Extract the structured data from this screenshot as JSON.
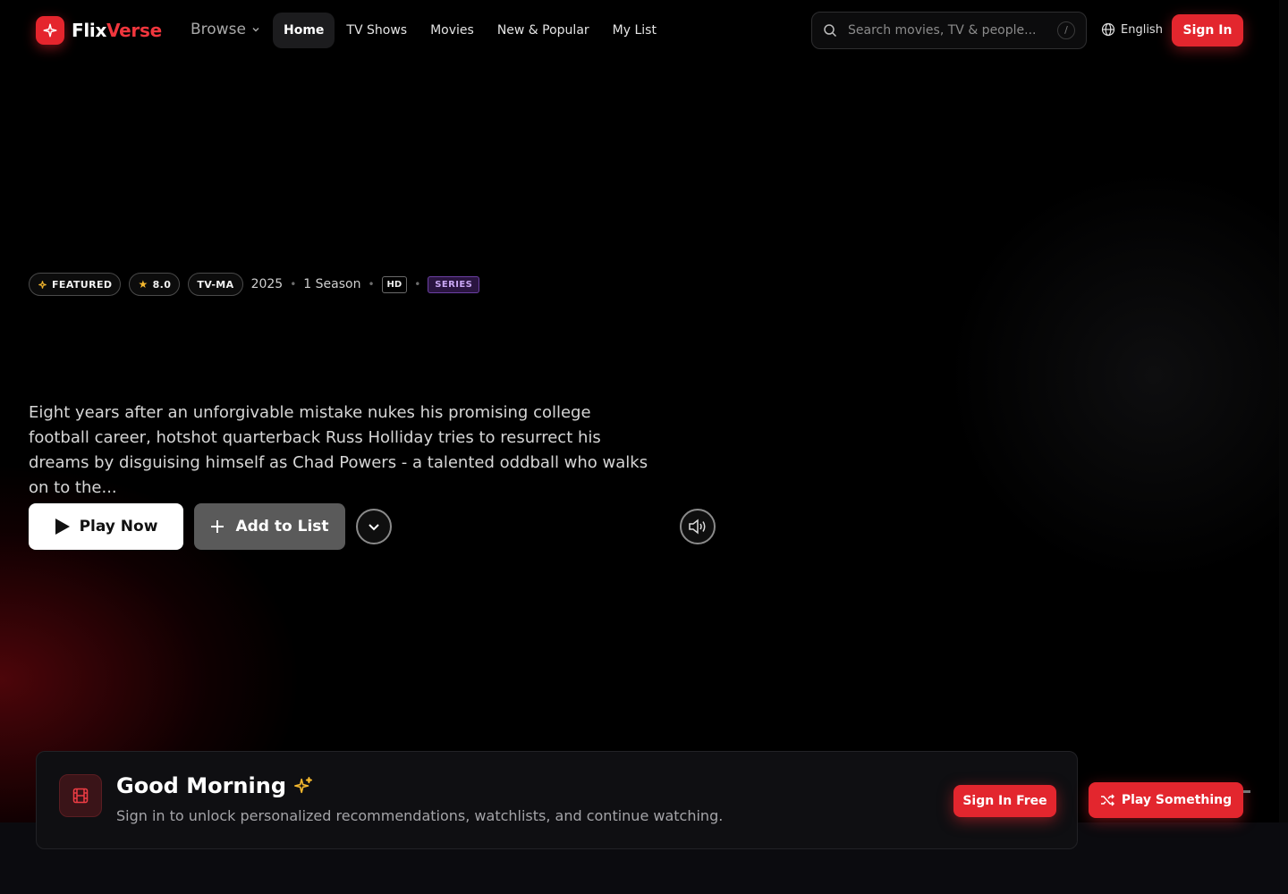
{
  "brand": {
    "name_part1": "Flix",
    "name_part2": "Verse",
    "accent": "#e3262e"
  },
  "nav": {
    "browse_label": "Browse",
    "links": [
      {
        "label": "Home",
        "active": true
      },
      {
        "label": "TV Shows"
      },
      {
        "label": "Movies"
      },
      {
        "label": "New & Popular"
      },
      {
        "label": "My List"
      }
    ],
    "search": {
      "placeholder": "Search movies, TV & people...",
      "shortcut": "/"
    },
    "language": "English",
    "signin_label": "Sign In"
  },
  "hero": {
    "meta": {
      "featured": "FEATURED",
      "rating": "8.0",
      "maturity": "TV-MA",
      "year": "2025",
      "seasons": "1 Season",
      "quality": "HD",
      "kind": "SERIES"
    },
    "description": "Eight years after an unforgivable mistake nukes his promising college football career, hotshot quarterback Russ Holliday tries to resurrect his dreams by disguising himself as Chad Powers - a talented oddball who walks on to the...",
    "play_label": "Play Now",
    "add_label": "Add to List"
  },
  "greeting": {
    "title": "Good Morning",
    "subtitle": "Sign in to unlock personalized recommendations, watchlists, and continue watching.",
    "button_label": "Sign In Free"
  },
  "play_something_label": "Play Something",
  "icons": [
    "sparkle-icon",
    "chevron-down-icon",
    "search-icon",
    "globe-icon",
    "star-icon",
    "play-icon",
    "plus-icon",
    "volume-icon",
    "film-icon",
    "shuffle-icon"
  ]
}
